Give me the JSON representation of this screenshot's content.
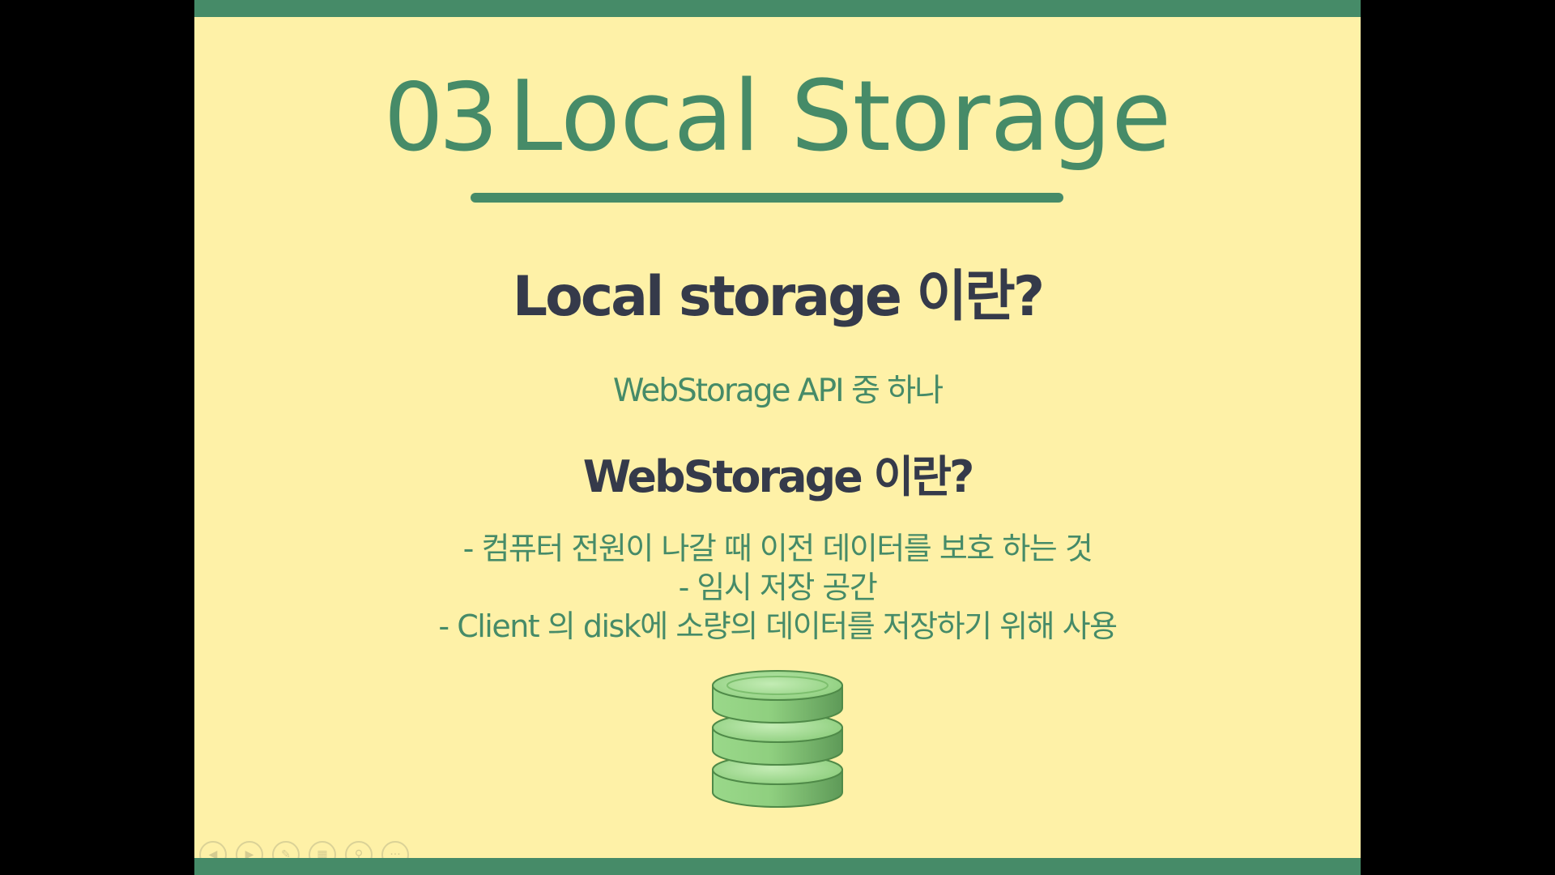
{
  "slide": {
    "title_number": "03",
    "title_text": "Local Storage",
    "heading1": "Local storage 이란?",
    "subtext1": "WebStorage API 중 하나",
    "heading2": "WebStorage 이란?",
    "bullets": [
      "- 컴퓨터 전원이 나갈 때 이전 데이터를 보호 하는 것",
      "- 임시 저장 공간",
      "-   Client 의 disk에 소량의 데이터를 저장하기 위해 사용"
    ]
  },
  "colors": {
    "background": "#fef1a7",
    "accent_green": "#468b68",
    "heading_dark": "#353a4a",
    "db_green": "#8fcf7f",
    "outside_black": "#000000"
  },
  "icons": {
    "illustration": "database-stack-icon",
    "controls": [
      "previous-icon",
      "next-icon",
      "pen-icon",
      "slides-grid-icon",
      "zoom-icon",
      "more-options-icon"
    ]
  }
}
